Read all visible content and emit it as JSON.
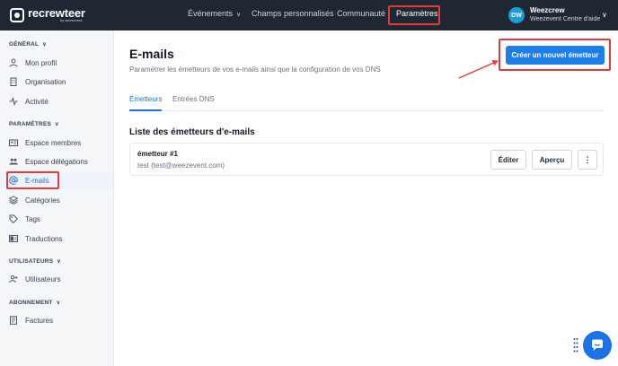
{
  "app": {
    "logo_name": "recrewteer",
    "logo_sub": "by weezevent"
  },
  "topnav": {
    "items": [
      {
        "label": "Événements"
      },
      {
        "label": "Champs personnalisés"
      },
      {
        "label": "Communauté"
      },
      {
        "label": "Paramètres"
      }
    ]
  },
  "user": {
    "initials": "DW",
    "name": "Weezcrew",
    "subtitle": "Weezevent Centre d'aide"
  },
  "sidebar": {
    "sections": [
      {
        "heading": "GÉNÉRAL",
        "items": [
          {
            "label": "Mon profil",
            "icon": "user-icon"
          },
          {
            "label": "Organisation",
            "icon": "building-icon"
          },
          {
            "label": "Activité",
            "icon": "activity-icon"
          }
        ]
      },
      {
        "heading": "PARAMÈTRES",
        "items": [
          {
            "label": "Espace membres",
            "icon": "id-card-icon"
          },
          {
            "label": "Espace délégations",
            "icon": "users-icon"
          },
          {
            "label": "E-mails",
            "icon": "at-icon",
            "active": true
          },
          {
            "label": "Catégories",
            "icon": "layers-icon"
          },
          {
            "label": "Tags",
            "icon": "tag-icon"
          },
          {
            "label": "Traductions",
            "icon": "translate-icon"
          }
        ]
      },
      {
        "heading": "UTILISATEURS",
        "items": [
          {
            "label": "Utilisateurs",
            "icon": "user-group-icon"
          }
        ]
      },
      {
        "heading": "ABONNEMENT",
        "items": [
          {
            "label": "Factures",
            "icon": "invoice-icon"
          }
        ]
      }
    ]
  },
  "main": {
    "title": "E-mails",
    "subtitle": "Paramétrer les émetteurs de vos e-mails ainsi que la configuration de vos DNS",
    "create_button": "Créer un nouvel émetteur",
    "tabs": [
      {
        "label": "Émetteurs",
        "active": true
      },
      {
        "label": "Entrées DNS"
      }
    ],
    "section_title": "Liste des émetteurs d'e-mails",
    "senders": [
      {
        "name": "émetteur #1",
        "email": "test (test@weezevent.com)"
      }
    ],
    "edit_button": "Éditer",
    "preview_button": "Aperçu",
    "more_button": "⋮"
  },
  "colors": {
    "topbar": "#1f2732",
    "accent": "#1a73e8",
    "highlight": "#e53935"
  }
}
